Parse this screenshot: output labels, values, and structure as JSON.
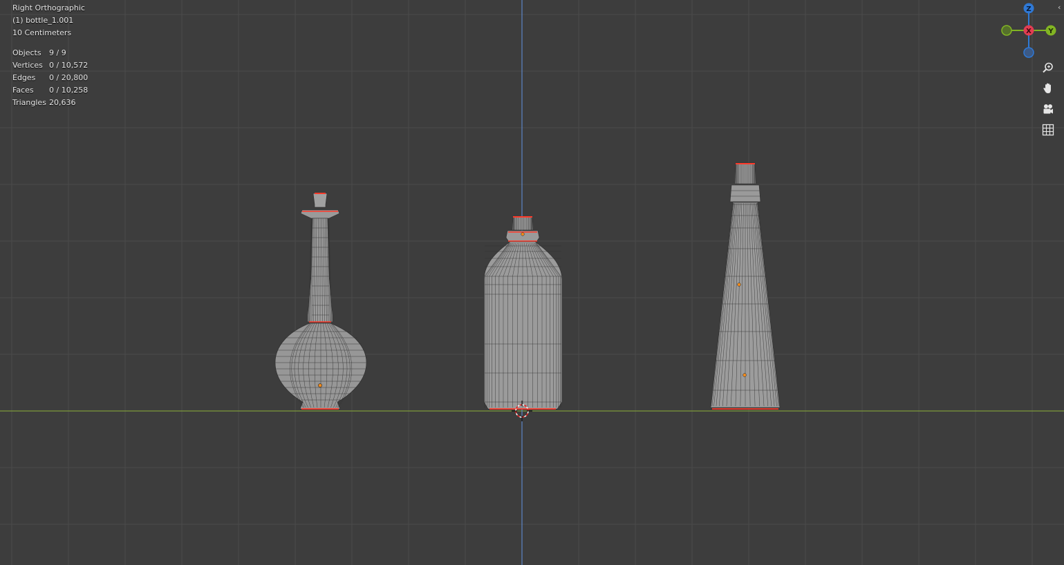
{
  "viewport": {
    "view_name": "Right Orthographic",
    "active_object": "(1) bottle_1.001",
    "grid_scale": "10 Centimeters",
    "stats": [
      {
        "key": "Objects",
        "value": "9 / 9"
      },
      {
        "key": "Vertices",
        "value": "0 / 10,572"
      },
      {
        "key": "Edges",
        "value": "0 / 20,800"
      },
      {
        "key": "Faces",
        "value": "0 / 10,258"
      },
      {
        "key": "Triangles",
        "value": "20,636"
      }
    ]
  },
  "gizmo": {
    "axes": [
      {
        "label": "Z",
        "color": "#2f79d6"
      },
      {
        "label": "X",
        "color": "#e23d52"
      },
      {
        "label": "Y",
        "color": "#82b523"
      }
    ]
  },
  "nav_buttons": [
    "zoom-icon",
    "pan-hand-icon",
    "camera-view-icon",
    "ortho-grid-icon"
  ],
  "colors": {
    "background": "#3d3d3d",
    "grid": "#4a4a4a",
    "axis_horizontal": "#7e9a3b",
    "axis_vertical": "#5e86c6",
    "mesh_fill": "#9a9a9a",
    "wire": "#2b2b2b",
    "selected_edge": "#ff3a2a"
  }
}
